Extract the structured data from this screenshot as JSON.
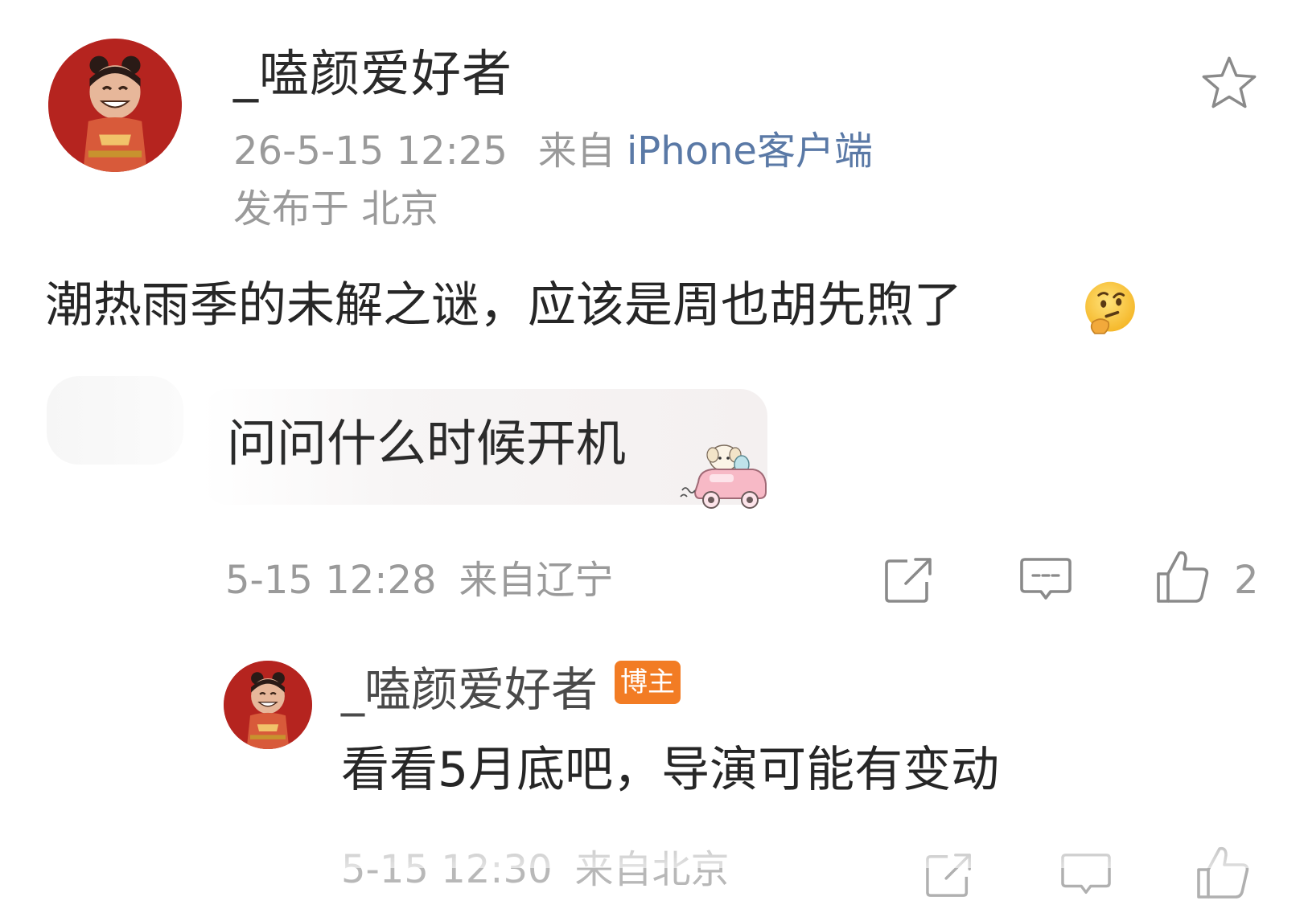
{
  "post": {
    "author": "_嗑颜爱好者",
    "timestamp": "26-5-15 12:25",
    "source_prefix": "来自",
    "source": "iPhone客户端",
    "location": "发布于 北京",
    "text": "潮热雨季的未解之谜，应该是周也胡先煦了",
    "emoji": "thinking-face"
  },
  "comment": {
    "text": "问问什么时候开机",
    "sticker": "puppy-car-sticker",
    "time": "5-15 12:28",
    "location": "来自辽宁",
    "like_count": "2"
  },
  "reply": {
    "author": "_嗑颜爱好者",
    "badge": "博主",
    "text": "看看5月底吧，导演可能有变动",
    "time": "5-15 12:30",
    "location": "来自北京"
  },
  "colors": {
    "link": "#5a79a6",
    "meta_gray": "#9a9a9a",
    "badge_orange": "#f27c24",
    "avatar_red": "#b3231f"
  },
  "icons": [
    "star-icon",
    "share-icon",
    "comment-icon",
    "like-icon"
  ]
}
